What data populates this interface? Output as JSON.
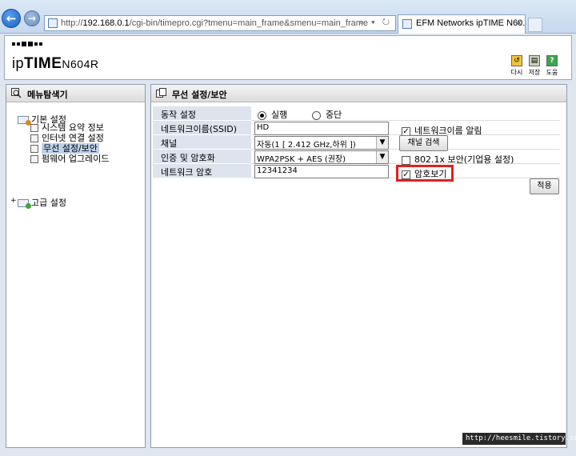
{
  "browser": {
    "url_prefix": "http://",
    "url_host": "192.168.0.1",
    "url_path": "/cgi-bin/timepro.cgi?tmenu=main_frame&smenu=main_frame",
    "tab_title": "EFM Networks ipTIME N60...",
    "tab_close": "×",
    "back_icon": "arrow-left-icon",
    "forward_icon": "arrow-right-icon",
    "address_tools": "⌕ ▾ ↻"
  },
  "header": {
    "logo_prefix": "ip",
    "logo_bold": "TIME",
    "logo_model": "N604R",
    "tools": [
      {
        "label": "다시",
        "icon": "reload-icon",
        "glyph": "↺"
      },
      {
        "label": "저장",
        "icon": "save-icon",
        "glyph": "▤"
      },
      {
        "label": "도움",
        "icon": "help-icon",
        "glyph": "?"
      }
    ]
  },
  "sidebar": {
    "title": "메뉴탐색기",
    "basic_folder": "기본 설정",
    "items": [
      {
        "label": "시스템 요약 정보"
      },
      {
        "label": "인터넷 연결 설정"
      },
      {
        "label": "무선 설정/보안",
        "selected": true
      },
      {
        "label": "펌웨어 업그레이드"
      }
    ],
    "advanced_folder": "고급 설정",
    "advanced_plus": "+"
  },
  "main": {
    "title": "무선 설정/보안",
    "fields": {
      "operation_label": "동작 설정",
      "operation_on": "실행",
      "operation_off": "중단",
      "ssid_label": "네트워크이름(SSID)",
      "ssid_value": "HD",
      "broadcast_label": "네트워크이름 알림",
      "channel_label": "채널",
      "channel_value": "자동(1 [ 2.412 GHz,하위 ])",
      "channel_scan_label": "채널 검색",
      "auth_label": "인증 및 암호화",
      "auth_value": "WPA2PSK + AES (권장)",
      "dot1x_label": "802.1x 보안(기업용 설정)",
      "password_label": "네트워크 암호",
      "password_value": "12341234",
      "show_password_label": "암호보기",
      "apply_label": "적용"
    },
    "state": {
      "operation": "실행",
      "broadcast_checked": true,
      "dot1x_checked": false,
      "show_password_checked": true
    },
    "colors": {
      "highlight": "#e02020",
      "label_bg": "#dde4ed",
      "selected_item": "#bcd0ea"
    }
  },
  "watermark": "http://heesmile.tistory.com"
}
